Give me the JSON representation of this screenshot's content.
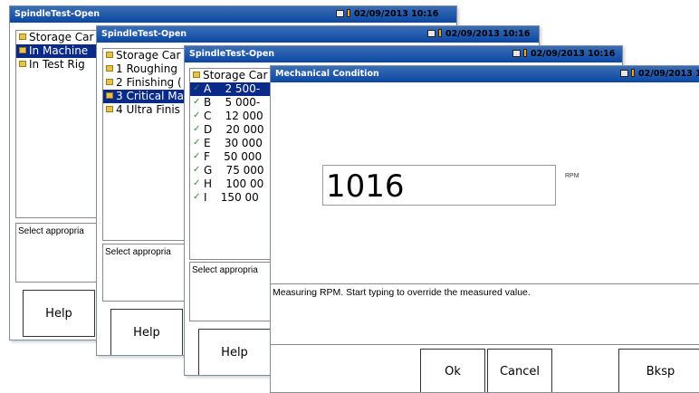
{
  "windows": [
    {
      "title": "SpindleTest-Open",
      "datetime": "02/09/2013 10:16",
      "items": [
        {
          "label": "Storage Car",
          "icon": "folder-icon",
          "selected": false
        },
        {
          "label": "In Machine",
          "icon": "folder-icon",
          "selected": true
        },
        {
          "label": "In Test Rig",
          "icon": "folder-icon",
          "selected": false
        }
      ],
      "message": "Select appropria",
      "help_label": "Help"
    },
    {
      "title": "SpindleTest-Open",
      "datetime": "02/09/2013 10:16",
      "items": [
        {
          "label": "Storage Car",
          "icon": "folder-icon",
          "selected": false
        },
        {
          "label": "1 Roughing",
          "icon": "folder-icon",
          "selected": false
        },
        {
          "label": "2 Finishing (",
          "icon": "folder-icon",
          "selected": false
        },
        {
          "label": "3 Critical Ma",
          "icon": "folder-icon",
          "selected": true
        },
        {
          "label": "4 Ultra Finis",
          "icon": "folder-icon",
          "selected": false
        }
      ],
      "message": "Select appropria",
      "help_label": "Help"
    },
    {
      "title": "SpindleTest-Open",
      "datetime": "02/09/2013 10:16",
      "items": [
        {
          "label": "Storage Car",
          "icon": "folder-icon",
          "selected": false
        },
        {
          "label": "A    2 500-",
          "icon": "leaf-icon",
          "selected": true
        },
        {
          "label": "B    5 000-",
          "icon": "leaf-icon",
          "selected": false
        },
        {
          "label": "C    12 000",
          "icon": "leaf-icon",
          "selected": false
        },
        {
          "label": "D    20 000",
          "icon": "leaf-icon",
          "selected": false
        },
        {
          "label": "E    30 000",
          "icon": "leaf-icon",
          "selected": false
        },
        {
          "label": "F    50 000",
          "icon": "leaf-icon",
          "selected": false
        },
        {
          "label": "G    75 000",
          "icon": "leaf-icon",
          "selected": false
        },
        {
          "label": "H    100 00",
          "icon": "leaf-icon",
          "selected": false
        },
        {
          "label": "I    150 00",
          "icon": "leaf-icon",
          "selected": false
        }
      ],
      "message": "Select appropria",
      "help_label": "Help"
    }
  ],
  "dialog": {
    "title": "Mechanical Condition",
    "datetime": "02/09/2013 10:1",
    "value": "1016",
    "unit": "RPM",
    "message": "Measuring RPM. Start typing to override the measured value.",
    "ok_label": "Ok",
    "cancel_label": "Cancel",
    "bksp_label": "Bksp"
  },
  "colors": {
    "titlebar": "#0b47a3",
    "selection": "#0a2a8a",
    "folder": "#e6c34a"
  }
}
